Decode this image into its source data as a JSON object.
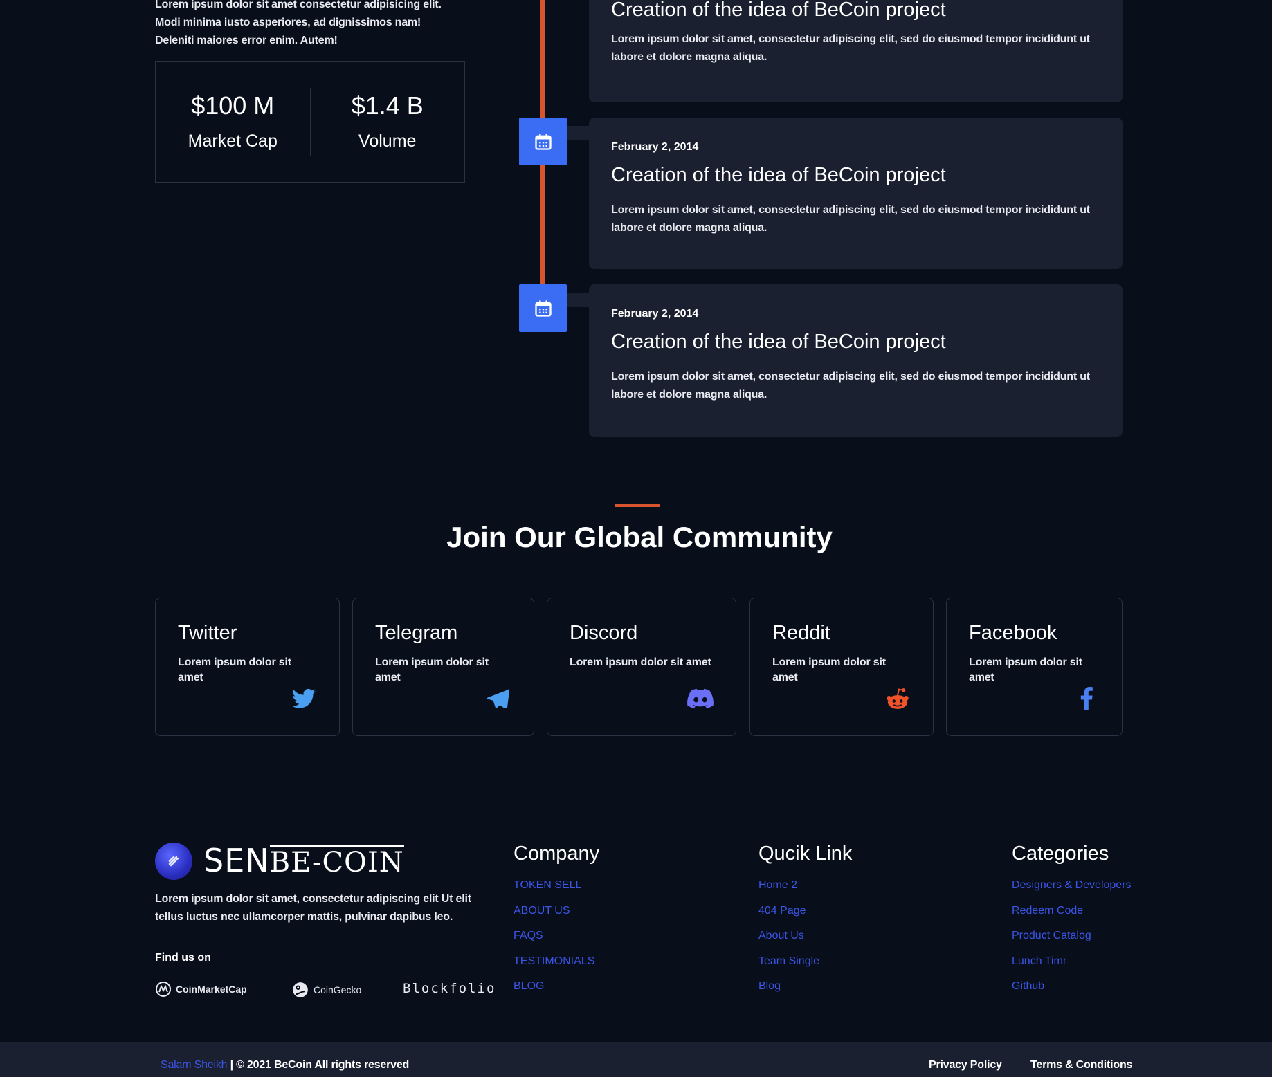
{
  "intro": {
    "text": "Lorem ipsum dolor sit amet consectetur adipisicing elit. Modi minima iusto asperiores, ad dignissimos nam! Deleniti maiores error enim. Autem!",
    "stats": [
      {
        "value": "$100 M",
        "label": "Market Cap"
      },
      {
        "value": "$1.4 B",
        "label": "Volume"
      }
    ]
  },
  "timeline": {
    "items": [
      {
        "date": "",
        "title": "Creation of the idea of BeCoin project",
        "desc": "Lorem ipsum dolor sit amet, consectetur adipiscing elit, sed do eiusmod tempor incididunt ut labore et dolore magna aliqua."
      },
      {
        "date": "February 2, 2014",
        "title": "Creation of the idea of BeCoin project",
        "desc": "Lorem ipsum dolor sit amet, consectetur adipiscing elit, sed do eiusmod tempor incididunt ut labore et dolore magna aliqua."
      },
      {
        "date": "February 2, 2014",
        "title": "Creation of the idea of BeCoin project",
        "desc": "Lorem ipsum dolor sit amet, consectetur adipiscing elit, sed do eiusmod tempor incididunt ut labore et dolore magna aliqua."
      }
    ],
    "icon": "calendar-icon",
    "colors": {
      "line": "#d7552e",
      "icon_bg": "#3b6cf4",
      "card_bg": "#1b2030"
    }
  },
  "community": {
    "title": "Join Our Global Community",
    "cards": [
      {
        "name": "Twitter",
        "desc": "Lorem ipsum dolor sit amet",
        "icon": "twitter-icon",
        "color": "#4a9ff0"
      },
      {
        "name": "Telegram",
        "desc": "Lorem ipsum dolor sit amet",
        "icon": "telegram-icon",
        "color": "#4a9ff0"
      },
      {
        "name": "Discord",
        "desc": "Lorem ipsum dolor sit amet",
        "icon": "discord-icon",
        "color": "#6a6ff5"
      },
      {
        "name": "Reddit",
        "desc": "Lorem ipsum dolor sit amet",
        "icon": "reddit-icon",
        "color": "#f0532a"
      },
      {
        "name": "Facebook",
        "desc": "Lorem ipsum dolor sit amet",
        "icon": "facebook-icon",
        "color": "#4a7ff0"
      }
    ]
  },
  "footer": {
    "brand": {
      "part1": "SEN",
      "part2": "BE-COIN"
    },
    "about": "Lorem ipsum dolor sit amet, consectetur adipiscing elit Ut elit tellus luctus nec ullamcorper mattis, pulvinar dapibus leo.",
    "find_us": "Find us on",
    "partners": [
      {
        "name": "CoinMarketCap",
        "icon": "coinmarketcap-icon"
      },
      {
        "name": "CoinGecko",
        "icon": "coingecko-icon"
      },
      {
        "name": "Blockfolio",
        "icon": ""
      }
    ],
    "columns": [
      {
        "title": "Company",
        "links": [
          "TOKEN SELL",
          "ABOUT US",
          "FAQS",
          "TESTIMONIALS",
          "BLOG"
        ]
      },
      {
        "title": "Qucik Link",
        "links": [
          "Home 2",
          "404 Page",
          "About Us",
          "Team Single",
          "Blog"
        ]
      },
      {
        "title": "Categories",
        "links": [
          "Designers & Developers",
          "Redeem Code",
          "Product Catalog",
          "Lunch Timr",
          "Github"
        ]
      }
    ],
    "link_color": "#3b55e6"
  },
  "bottom": {
    "author": "Salam Sheikh",
    "copyright": " | © 2021 BeCoin All rights reserved",
    "privacy": "Privacy Policy",
    "terms": "Terms & Conditions"
  }
}
